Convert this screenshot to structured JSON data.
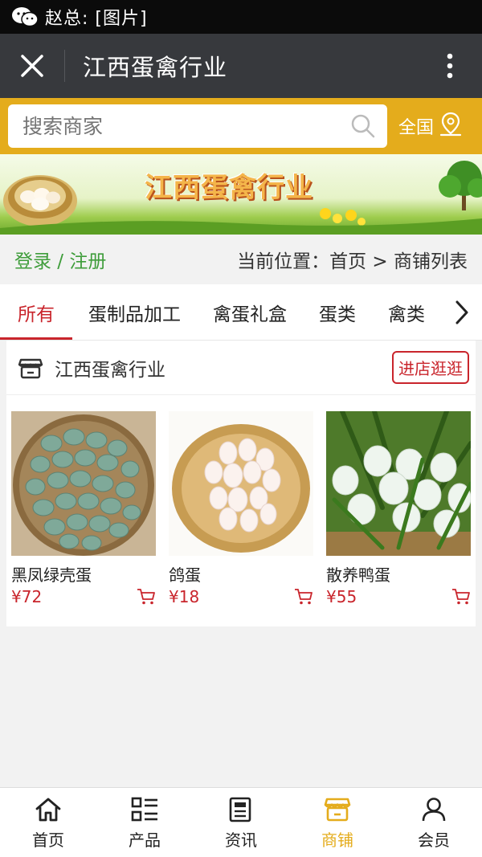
{
  "status": {
    "notification": "赵总: [图片]"
  },
  "header": {
    "title": "江西蛋禽行业"
  },
  "search": {
    "placeholder": "搜索商家",
    "region": "全国"
  },
  "banner": {
    "title": "江西蛋禽行业"
  },
  "breadcrumb": {
    "login": "登录 / 注册",
    "location": "当前位置：首页 > 商铺列表"
  },
  "tabs": [
    {
      "label": "所有",
      "active": true
    },
    {
      "label": "蛋制品加工"
    },
    {
      "label": "禽蛋礼盒"
    },
    {
      "label": "蛋类"
    },
    {
      "label": "禽类"
    }
  ],
  "shop": {
    "name": "江西蛋禽行业",
    "enter_label": "进店逛逛",
    "products": [
      {
        "name": "黑凤绿壳蛋",
        "price": "¥72"
      },
      {
        "name": "鸽蛋",
        "price": "¥18"
      },
      {
        "name": "散养鸭蛋",
        "price": "¥55"
      }
    ]
  },
  "nav": [
    {
      "label": "首页",
      "icon": "home-icon"
    },
    {
      "label": "产品",
      "icon": "grid-list-icon"
    },
    {
      "label": "资讯",
      "icon": "document-icon"
    },
    {
      "label": "商铺",
      "icon": "store-icon",
      "active": true
    },
    {
      "label": "会员",
      "icon": "user-icon"
    }
  ],
  "colors": {
    "accent": "#e4ac1c",
    "price": "#c9252c",
    "login": "#3f9d3b",
    "header": "#37393d"
  }
}
